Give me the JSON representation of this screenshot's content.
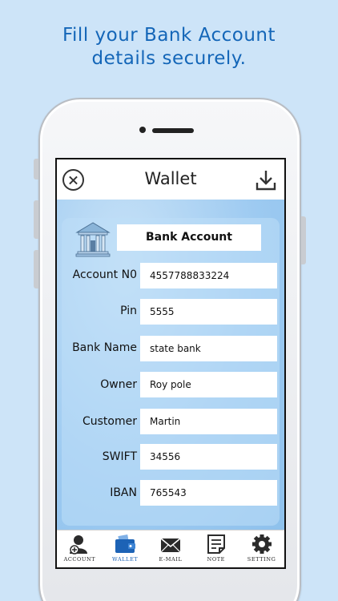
{
  "headline": {
    "line1": "Fill your Bank Account",
    "line2": "details securely."
  },
  "app": {
    "title": "Wallet",
    "close_icon": "close-icon",
    "download_icon": "download-icon"
  },
  "form": {
    "section_title": "Bank Account",
    "section_icon": "bank-icon",
    "fields": [
      {
        "label": "Account N0",
        "value": "4557788833224"
      },
      {
        "label": "Pin",
        "value": "5555"
      },
      {
        "label": "Bank Name",
        "value": "state bank"
      },
      {
        "label": "Owner",
        "value": "Roy pole"
      },
      {
        "label": "Customer",
        "value": "Martin"
      },
      {
        "label": "SWIFT",
        "value": "34556"
      },
      {
        "label": "IBAN",
        "value": "765543"
      }
    ]
  },
  "tabs": [
    {
      "label": "ACCOUNT",
      "icon": "account-icon",
      "active": false
    },
    {
      "label": "WALLET",
      "icon": "wallet-icon",
      "active": true
    },
    {
      "label": "E-MAIL",
      "icon": "email-icon",
      "active": false
    },
    {
      "label": "NOTE",
      "icon": "note-icon",
      "active": false
    },
    {
      "label": "SETTING",
      "icon": "gear-icon",
      "active": false
    }
  ],
  "colors": {
    "background": "#cde4f8",
    "headline": "#1466b8",
    "active_tab": "#1d63b6"
  }
}
